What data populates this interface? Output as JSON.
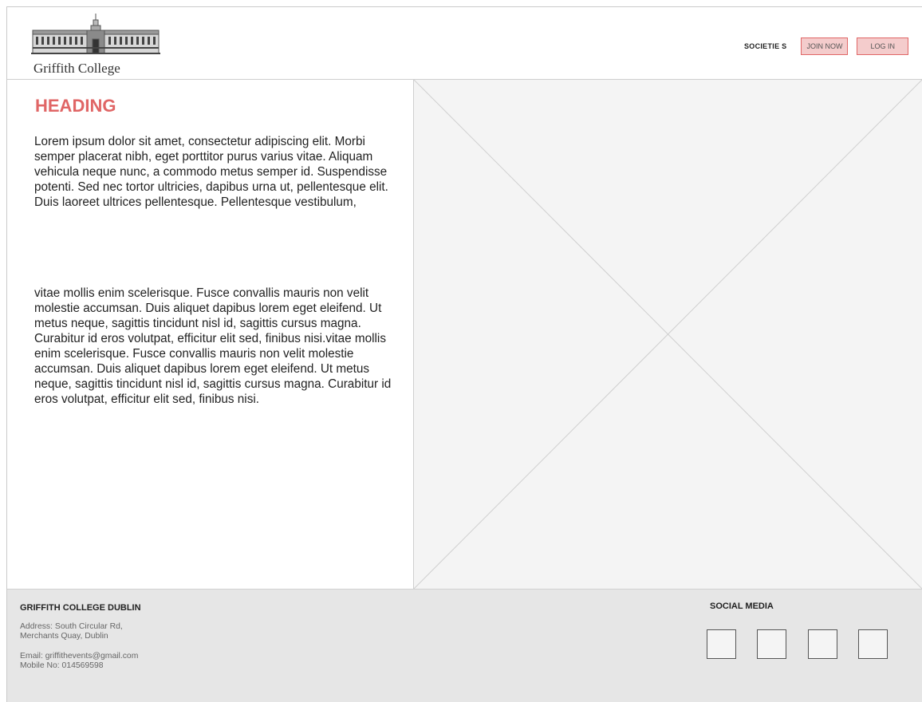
{
  "header": {
    "logo_text": "Griffith College",
    "nav": {
      "societies_label": "SOCIETIE S",
      "join_label": "JOIN NOW",
      "login_label": "LOG IN"
    }
  },
  "main": {
    "heading": "HEADING",
    "paragraph1": "Lorem ipsum dolor sit amet, consectetur adipiscing elit. Morbi semper placerat nibh, eget porttitor purus varius vitae. Aliquam vehicula neque nunc, a commodo metus semper id. Suspendisse potenti. Sed nec tortor ultricies, dapibus urna ut, pellentesque elit. Duis laoreet ultrices pellentesque. Pellentesque vestibulum,",
    "paragraph2": "vitae mollis enim scelerisque. Fusce convallis mauris non velit molestie accumsan. Duis aliquet dapibus lorem eget eleifend. Ut metus neque, sagittis tincidunt nisl id, sagittis cursus magna. Curabitur id eros volutpat, efficitur elit sed, finibus nisi.vitae mollis enim scelerisque. Fusce convallis mauris non velit molestie accumsan. Duis aliquet dapibus lorem eget eleifend. Ut metus neque, sagittis tincidunt nisl id, sagittis cursus magna. Curabitur id eros volutpat, efficitur elit sed, finibus nisi.",
    "image_placeholder_icon": "image-placeholder-icon"
  },
  "footer": {
    "title": "GRIFFITH COLLEGE DUBLIN",
    "address_line1": "Address: South Circular Rd,",
    "address_line2": "Merchants Quay, Dublin",
    "email": "Email: griffithevents@gmail.com",
    "mobile": "Mobile No: 014569598",
    "social_title": "SOCIAL MEDIA",
    "social_icons": [
      "social-icon-1",
      "social-icon-2",
      "social-icon-3",
      "social-icon-4"
    ]
  },
  "colors": {
    "accent": "#e06666",
    "button_fill": "#f4cccc",
    "footer_bg": "#e6e6e6",
    "placeholder_bg": "#f4f4f4"
  }
}
